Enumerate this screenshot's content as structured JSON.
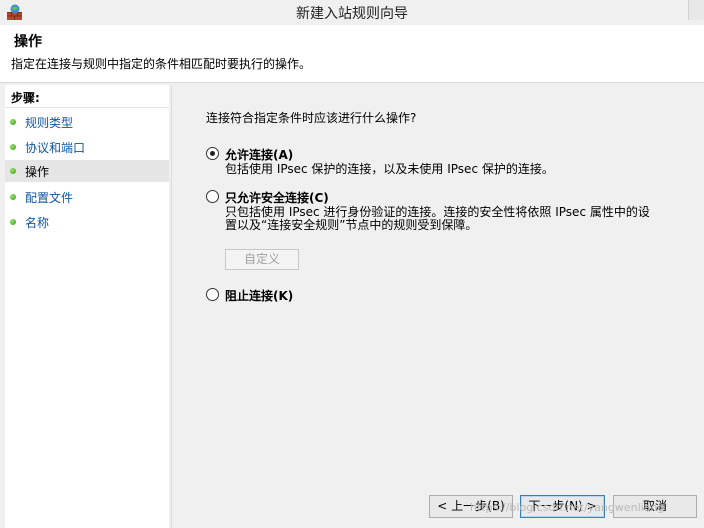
{
  "window": {
    "title": "新建入站规则向导"
  },
  "header": {
    "title": "操作",
    "description": "指定在连接与规则中指定的条件相匹配时要执行的操作。"
  },
  "steps": {
    "heading": "步骤:",
    "items": [
      {
        "label": "规则类型",
        "current": false
      },
      {
        "label": "协议和端口",
        "current": false
      },
      {
        "label": "操作",
        "current": true
      },
      {
        "label": "配置文件",
        "current": false
      },
      {
        "label": "名称",
        "current": false
      }
    ]
  },
  "main": {
    "question": "连接符合指定条件时应该进行什么操作?",
    "options": [
      {
        "label": "允许连接(A)",
        "description": "包括使用 IPsec 保护的连接，以及未使用 IPsec 保护的连接。",
        "checked": true
      },
      {
        "label": "只允许安全连接(C)",
        "description_line1": "只包括使用 IPsec 进行身份验证的连接。连接的安全性将依照 IPsec 属性中的设",
        "description_line2": "置以及“连接安全规则”节点中的规则受到保障。",
        "checked": false
      },
      {
        "label": "阻止连接(K)",
        "checked": false
      }
    ],
    "customize_button": "自定义"
  },
  "buttons": {
    "back": "< 上一步(B)",
    "next": "下一步(N) >",
    "cancel": "取消"
  },
  "watermark": "https://blog.csdn.net/yangwenliang"
}
